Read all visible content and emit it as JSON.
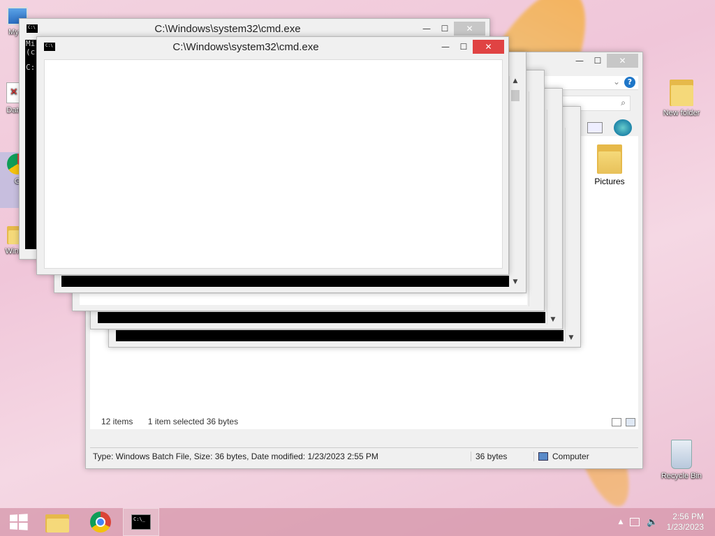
{
  "desktop": {
    "icons_left": [
      {
        "label": "My C",
        "icon": "computer-icon"
      },
      {
        "label": "Data",
        "icon": "file-shortcut-icon"
      },
      {
        "label": "G",
        "icon": "chrome-shortcut-icon"
      },
      {
        "label": "Window",
        "icon": "folder-icon"
      }
    ],
    "icons_right": [
      {
        "label": "New folder",
        "icon": "folder-icon"
      },
      {
        "label": "Recycle Bin",
        "icon": "recycle-bin-icon"
      }
    ]
  },
  "cmd_windows": {
    "title": "C:\\Windows\\system32\\cmd.exe",
    "minimize": "—",
    "maximize": "☐",
    "close": "✕",
    "background_text": {
      "line1": "Mi",
      "line2": "(c",
      "line3": "C:"
    }
  },
  "explorer": {
    "item_label": "Pictures",
    "status_items": "12 items",
    "status_selected": "1 item selected  36 bytes",
    "details": "Type: Windows Batch File, Size: 36 bytes, Date modified: 1/23/2023 2:55 PM",
    "size": "36 bytes",
    "location": "Computer",
    "search_icon": "search-icon",
    "help_icon": "help-icon"
  },
  "taskbar": {
    "start_icon": "windows-start-icon",
    "apps": [
      {
        "name": "file-explorer-icon"
      },
      {
        "name": "chrome-icon"
      },
      {
        "name": "cmd-icon"
      }
    ],
    "time": "2:56 PM",
    "date": "1/23/2023"
  },
  "colors": {
    "close_red": "#e04343",
    "taskbar": "#d696aa"
  }
}
